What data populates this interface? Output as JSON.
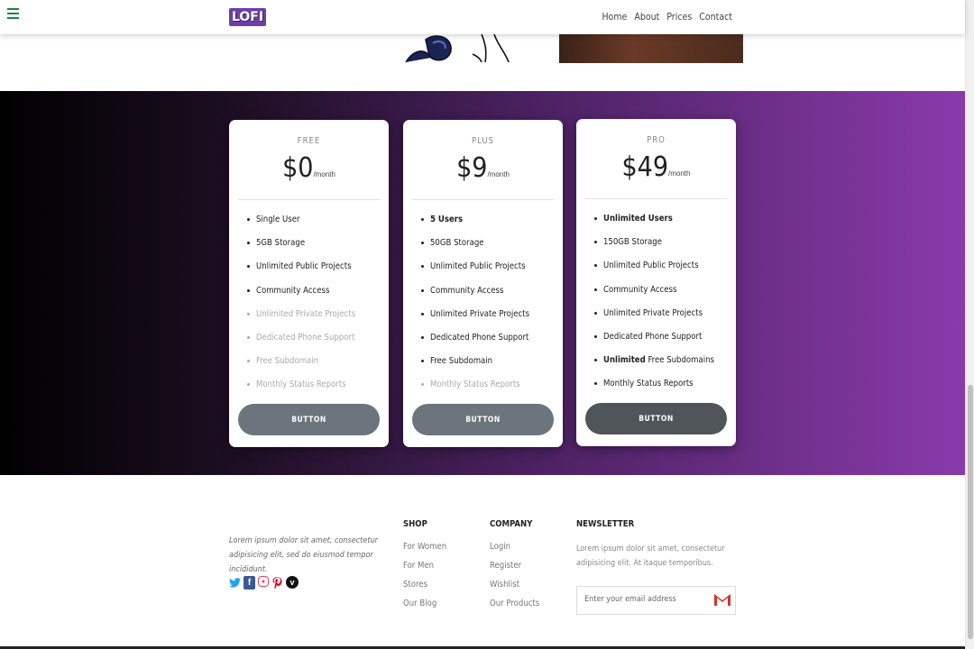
{
  "nav": {
    "logo": "LOFI",
    "links": [
      "Home",
      "About",
      "Prices",
      "Contact"
    ]
  },
  "pricing": {
    "plans": [
      {
        "tier": "FREE",
        "price": "$0",
        "period": "/month",
        "features": [
          {
            "text": "Single User",
            "state": "normal"
          },
          {
            "text": "5GB Storage",
            "state": "normal"
          },
          {
            "text": "Unlimited Public Projects",
            "state": "normal"
          },
          {
            "text": "Community Access",
            "state": "normal"
          },
          {
            "text": "Unlimited Private Projects",
            "state": "muted"
          },
          {
            "text": "Dedicated Phone Support",
            "state": "muted"
          },
          {
            "text": "Free Subdomain",
            "state": "muted"
          },
          {
            "text": "Monthly Status Reports",
            "state": "muted"
          }
        ],
        "button": "BUTTON"
      },
      {
        "tier": "PLUS",
        "price": "$9",
        "period": "/month",
        "features": [
          {
            "text": "5 Users",
            "state": "bold"
          },
          {
            "text": "50GB Storage",
            "state": "normal"
          },
          {
            "text": "Unlimited Public Projects",
            "state": "normal"
          },
          {
            "text": "Community Access",
            "state": "normal"
          },
          {
            "text": "Unlimited Private Projects",
            "state": "normal"
          },
          {
            "text": "Dedicated Phone Support",
            "state": "normal"
          },
          {
            "text": "Free Subdomain",
            "state": "normal"
          },
          {
            "text": "Monthly Status Reports",
            "state": "muted"
          }
        ],
        "button": "BUTTON"
      },
      {
        "tier": "PRO",
        "price": "$49",
        "period": "/month",
        "features": [
          {
            "text": "Unlimited Users",
            "state": "bold"
          },
          {
            "text": "150GB Storage",
            "state": "normal"
          },
          {
            "text": "Unlimited Public Projects",
            "state": "normal"
          },
          {
            "text": "Community Access",
            "state": "normal"
          },
          {
            "text": "Unlimited Private Projects",
            "state": "normal"
          },
          {
            "text": "Dedicated Phone Support",
            "state": "normal"
          },
          {
            "text": "Free Subdomains",
            "state": "normal",
            "prefix_bold": "Unlimited"
          },
          {
            "text": "Monthly Status Reports",
            "state": "normal"
          }
        ],
        "button": "BUTTON"
      }
    ]
  },
  "footer": {
    "about": "Lorem ipsum dolor sit amet, consectetur adipisicing elit, sed do eiusmod tempor incididunt.",
    "social_icons": [
      "twitter-icon",
      "facebook-icon",
      "instagram-icon",
      "pinterest-icon",
      "vimeo-icon"
    ],
    "shop": {
      "title": "SHOP",
      "links": [
        "For Women",
        "For Men",
        "Stores",
        "Our Blog"
      ]
    },
    "company": {
      "title": "COMPANY",
      "links": [
        "Login",
        "Register",
        "Wishlist",
        "Our Products"
      ]
    },
    "newsletter": {
      "title": "NEWSLETTER",
      "text": "Lorem ipsum dolor sit amet, consectetur adipisicing elit. At itaque temporibus.",
      "placeholder": "Enter your email address"
    }
  },
  "colors": {
    "brand": "#6b3fa8",
    "hamburger": "#15883a",
    "gradient_end": "#8a3aab"
  }
}
